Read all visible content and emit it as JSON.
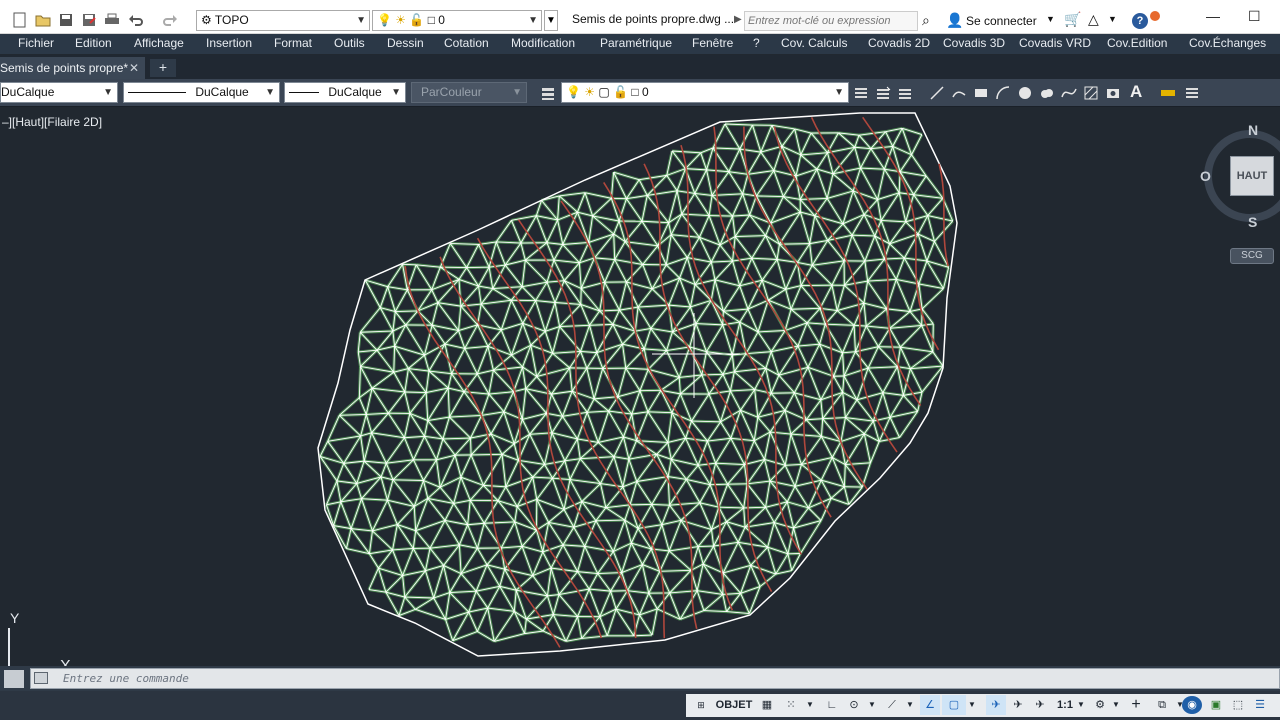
{
  "titlebar": {
    "layer_dropdown": "TOPO",
    "layer_state_value": "0",
    "document_title": "Semis de points propre.dwg ...",
    "search_placeholder": "Entrez mot-clé ou expression",
    "sign_in": "Se connecter",
    "help": "?",
    "minimize": "—",
    "maximize": "☐"
  },
  "menu": {
    "items": [
      "Fichier",
      "Edition",
      "Affichage",
      "Insertion",
      "Format",
      "Outils",
      "Dessin",
      "Cotation",
      "Modification",
      "Paramétrique",
      "Fenêtre",
      "?",
      "Cov. Calculs",
      "Covadis 2D",
      "Covadis 3D",
      "Covadis VRD",
      "Cov.Edition",
      "Cov.Échanges"
    ]
  },
  "tabs": {
    "active_tab": "Semis de points propre*",
    "close": "✕",
    "new_tab": "+"
  },
  "properties": {
    "color": "DuCalque",
    "linetype": "DuCalque",
    "lineweight": "DuCalque",
    "plotstyle": "ParCouleur",
    "layer_value": "0"
  },
  "viewport": {
    "label": "–][Haut][Filaire 2D]",
    "viewcube": {
      "north": "N",
      "south": "S",
      "west": "O",
      "face": "HAUT",
      "wcs": "SCG"
    },
    "ucs_y": "Y",
    "ucs_x": "X",
    "colors": {
      "background": "#212830",
      "mesh_edge": "#ffffff",
      "mesh_glow": "#6fd36f",
      "contour": "#b0473c",
      "labels": "#22ff22"
    }
  },
  "command": {
    "placeholder": "Entrez une commande"
  },
  "status": {
    "objet": "OBJET",
    "scale": "1:1"
  }
}
